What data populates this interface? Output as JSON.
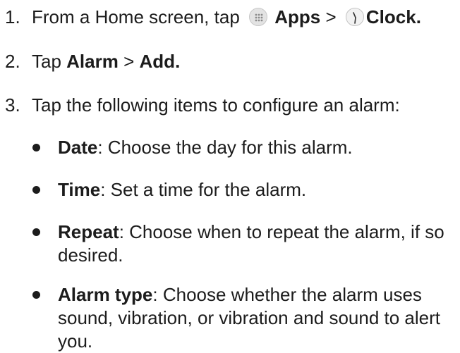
{
  "steps": [
    {
      "number": "1.",
      "prefix": "From a Home screen, tap",
      "apps_label": "Apps",
      "separator": ">",
      "clock_label": "Clock",
      "suffix": "."
    },
    {
      "number": "2.",
      "prefix": "Tap",
      "alarm_label": "Alarm",
      "separator": ">",
      "add_label": "Add",
      "suffix": "."
    },
    {
      "number": "3.",
      "text": "Tap the following items to configure an alarm:"
    }
  ],
  "bullets": [
    {
      "term": "Date",
      "desc": ": Choose the day for this alarm."
    },
    {
      "term": "Time",
      "desc": ": Set a time for the alarm."
    },
    {
      "term": "Repeat",
      "desc": ": Choose when to repeat the alarm, if so desired."
    },
    {
      "term": "Alarm type",
      "desc": ": Choose whether the alarm uses sound, vibration, or vibration and sound to alert you."
    }
  ],
  "icons": {
    "apps": "apps-grid-icon",
    "clock": "clock-icon"
  }
}
